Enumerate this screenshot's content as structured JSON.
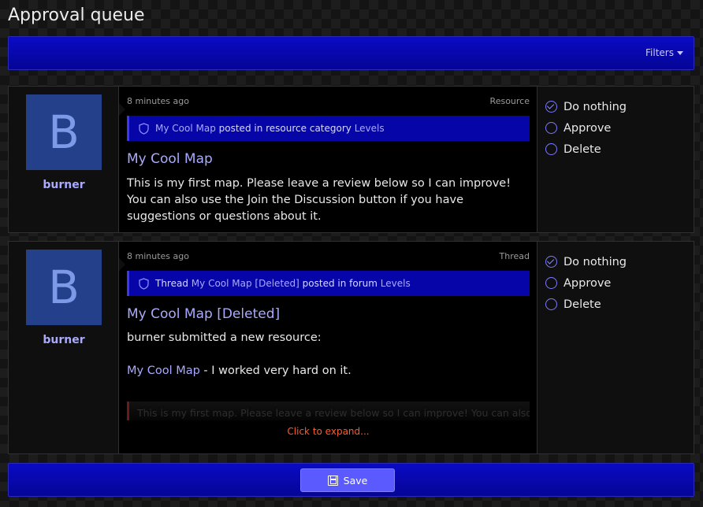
{
  "page": {
    "title": "Approval queue"
  },
  "filters": {
    "label": "Filters"
  },
  "items": [
    {
      "avatar_letter": "B",
      "username": "burner",
      "time": "8 minutes ago",
      "content_type": "Resource",
      "notice": {
        "prefix": "",
        "subject": "My Cool Map",
        "verb": "posted in resource category",
        "target": "Levels"
      },
      "title": "My Cool Map",
      "body": "This is my first map. Please leave a review below so I can improve! You can also use the Join the Discussion button if you have suggestions or questions about it.",
      "actions": [
        "Do nothing",
        "Approve",
        "Delete"
      ],
      "selected_action": "Do nothing"
    },
    {
      "avatar_letter": "B",
      "username": "burner",
      "time": "8 minutes ago",
      "content_type": "Thread",
      "notice": {
        "prefix": "Thread",
        "subject": "My Cool Map [Deleted]",
        "verb": "posted in forum",
        "target": "Levels"
      },
      "title": "My Cool Map [Deleted]",
      "body_line1": "burner submitted a new resource:",
      "body_link": "My Cool Map",
      "body_rest": " - I worked very hard on it.",
      "quote": "This is my first map. Please leave a review below so I can improve! You can also use",
      "expand_label": "Click to expand...",
      "actions": [
        "Do nothing",
        "Approve",
        "Delete"
      ],
      "selected_action": "Do nothing"
    }
  ],
  "footer": {
    "save_label": "Save"
  },
  "colors": {
    "accent": "#0606a8",
    "link": "#a9a9ff",
    "button": "#5a5aff",
    "expand": "#ff5a2a"
  }
}
